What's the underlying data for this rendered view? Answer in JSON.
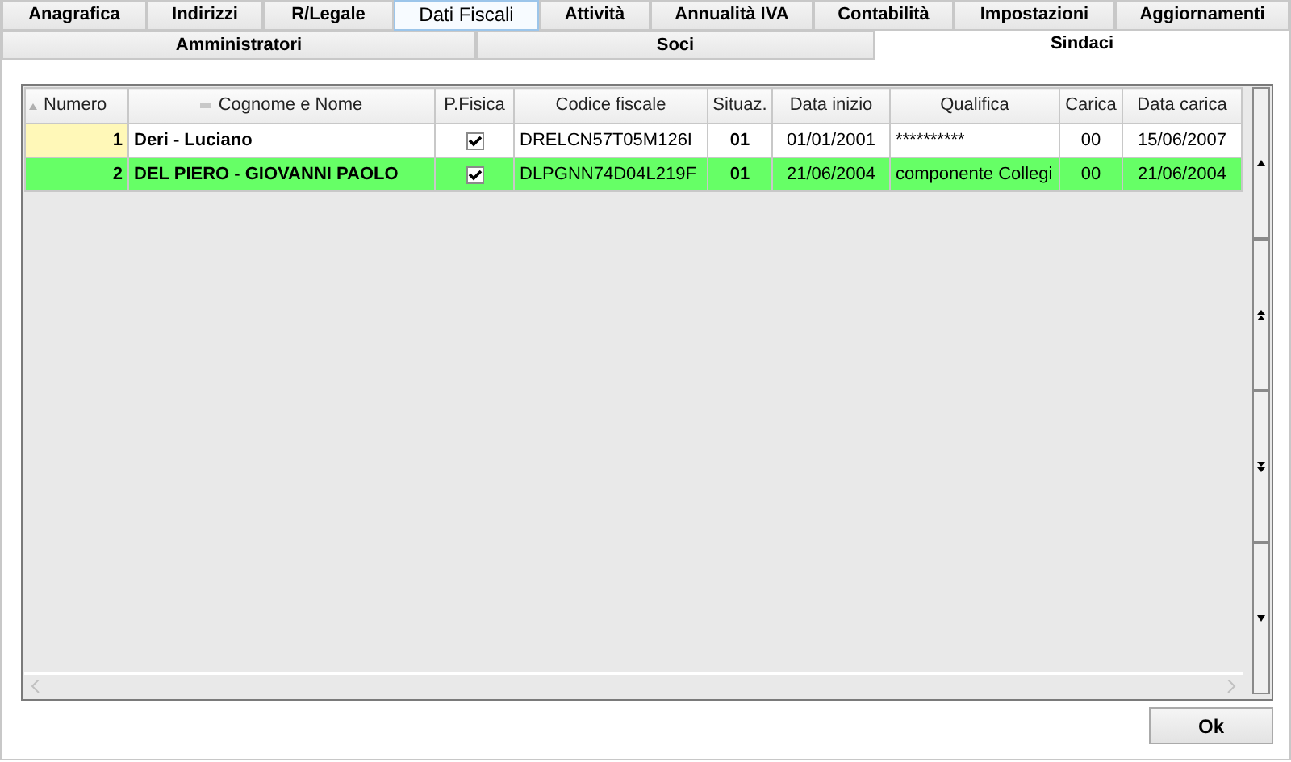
{
  "tabs_top": [
    {
      "label": "Anagrafica",
      "selected": false,
      "highlighted": false
    },
    {
      "label": "Indirizzi",
      "selected": false,
      "highlighted": false
    },
    {
      "label": "R/Legale",
      "selected": false,
      "highlighted": false
    },
    {
      "label": "Dati Fiscali",
      "selected": false,
      "highlighted": true
    },
    {
      "label": "Attività",
      "selected": false,
      "highlighted": false
    },
    {
      "label": "Annualità IVA",
      "selected": false,
      "highlighted": false
    },
    {
      "label": "Contabilità",
      "selected": false,
      "highlighted": false
    },
    {
      "label": "Impostazioni",
      "selected": false,
      "highlighted": false
    },
    {
      "label": "Aggiornamenti",
      "selected": false,
      "highlighted": false
    }
  ],
  "tabs_sub": [
    {
      "label": "Amministratori",
      "selected": false
    },
    {
      "label": "Soci",
      "selected": false
    },
    {
      "label": "Sindaci",
      "selected": true
    }
  ],
  "table": {
    "columns": [
      {
        "label": "Numero",
        "sorted": true
      },
      {
        "label": "Cognome e Nome",
        "grouped": true
      },
      {
        "label": "P.Fisica"
      },
      {
        "label": "Codice fiscale"
      },
      {
        "label": "Situaz."
      },
      {
        "label": "Data inizio"
      },
      {
        "label": "Qualifica"
      },
      {
        "label": "Carica"
      },
      {
        "label": "Data carica"
      }
    ],
    "rows": [
      {
        "selected": false,
        "numero": "1",
        "nome": "Deri - Luciano",
        "pfisica": true,
        "codice": "DRELCN57T05M126I",
        "situaz": "01",
        "data_inizio": "01/01/2001",
        "qualifica": "**********",
        "carica": "00",
        "data_carica": "15/06/2007"
      },
      {
        "selected": true,
        "numero": "2",
        "nome": "DEL PIERO - GIOVANNI PAOLO",
        "pfisica": true,
        "codice": "DLPGNN74D04L219F",
        "situaz": "01",
        "data_inizio": "21/06/2004",
        "qualifica": "componente Collegi",
        "carica": "00",
        "data_carica": "21/06/2004"
      }
    ]
  },
  "buttons": [
    {
      "label": "Ok"
    }
  ]
}
